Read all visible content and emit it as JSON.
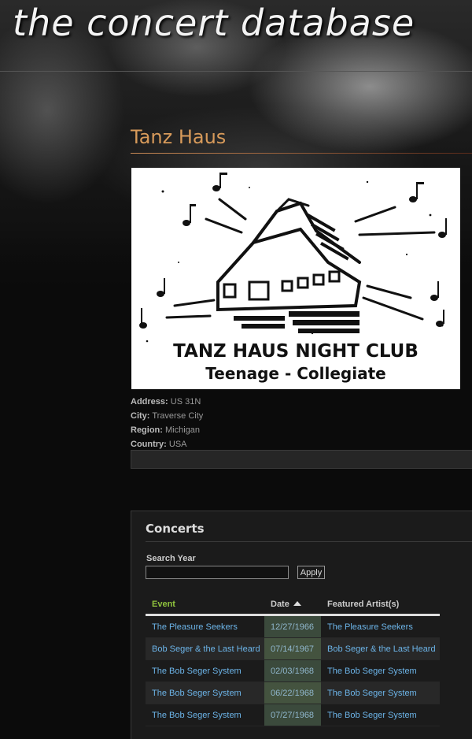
{
  "site": {
    "title": "the concert database"
  },
  "venue": {
    "name": "Tanz Haus",
    "flyer": {
      "line1": "TANZ HAUS NIGHT CLUB",
      "line2": "Teenage - Collegiate"
    },
    "address_label": "Address:",
    "address": "US 31N",
    "city_label": "City:",
    "city": "Traverse City",
    "region_label": "Region:",
    "region": "Michigan",
    "country_label": "Country:",
    "country": "USA"
  },
  "concerts": {
    "heading": "Concerts",
    "search_label": "Search Year",
    "search_value": "",
    "apply_label": "Apply",
    "columns": {
      "event": "Event",
      "date": "Date",
      "artist": "Featured Artist(s)"
    },
    "rows": [
      {
        "event": "The Pleasure Seekers",
        "date": "12/27/1966",
        "artist": "The Pleasure Seekers"
      },
      {
        "event": "Bob Seger & the Last Heard",
        "date": "07/14/1967",
        "artist": "Bob Seger & the Last Heard"
      },
      {
        "event": "The Bob Seger System",
        "date": "02/03/1968",
        "artist": "The Bob Seger System"
      },
      {
        "event": "The Bob Seger System",
        "date": "06/22/1968",
        "artist": "The Bob Seger System"
      },
      {
        "event": "The Bob Seger System",
        "date": "07/27/1968",
        "artist": "The Bob Seger System"
      }
    ]
  },
  "colors": {
    "venue_title": "#d79a5a",
    "link": "#6cb4e8",
    "event_header": "#8fc23d"
  }
}
